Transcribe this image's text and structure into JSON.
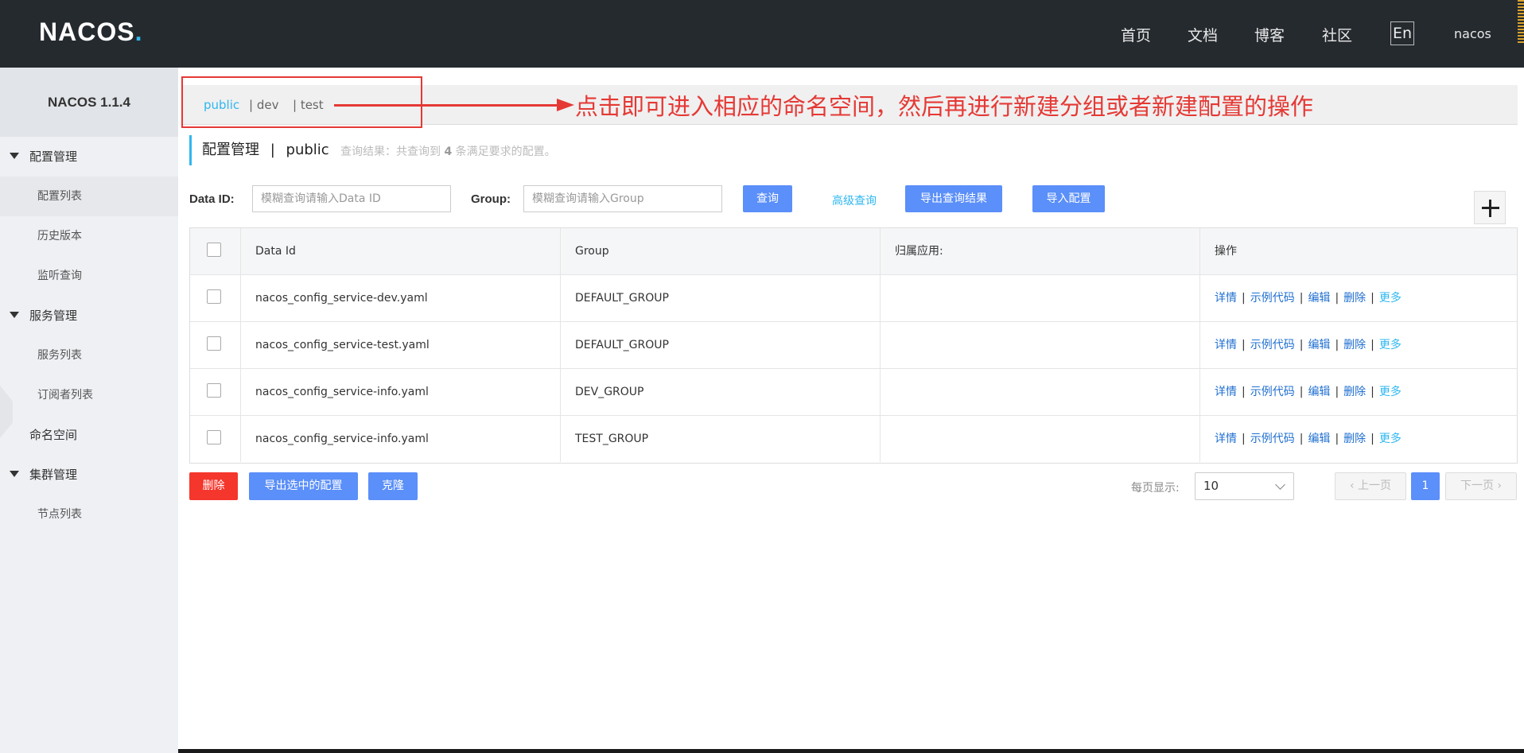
{
  "header": {
    "logo": "NACOS.",
    "nav": [
      "首页",
      "文档",
      "博客",
      "社区"
    ],
    "lang": "En",
    "user": "nacos"
  },
  "sidebar": {
    "title": "NACOS 1.1.4",
    "groups": [
      {
        "label": "配置管理",
        "items": [
          "配置列表",
          "历史版本",
          "监听查询"
        ]
      },
      {
        "label": "服务管理",
        "items": [
          "服务列表",
          "订阅者列表"
        ]
      },
      {
        "label": "命名空间"
      },
      {
        "label": "集群管理",
        "items": [
          "节点列表"
        ]
      }
    ]
  },
  "namespaces": [
    "public",
    "| dev",
    "| test"
  ],
  "annotation": "点击即可进入相应的命名空间，然后再进行新建分组或者新建配置的操作",
  "title": {
    "main": "配置管理",
    "sep": "|",
    "ns": "public",
    "result_prefix": "查询结果：共查询到",
    "result_count": "4",
    "result_suffix": "条满足要求的配置。"
  },
  "search": {
    "dataid_label": "Data ID:",
    "dataid_placeholder": "模糊查询请输入Data ID",
    "group_label": "Group:",
    "group_placeholder": "模糊查询请输入Group",
    "query_btn": "查询",
    "advanced": "高级查询",
    "export_results": "导出查询结果",
    "import": "导入配置"
  },
  "table": {
    "columns": [
      "Data Id",
      "Group",
      "归属应用:",
      "操作"
    ],
    "rows": [
      {
        "data_id": "nacos_config_service-dev.yaml",
        "group": "DEFAULT_GROUP",
        "app": ""
      },
      {
        "data_id": "nacos_config_service-test.yaml",
        "group": "DEFAULT_GROUP",
        "app": ""
      },
      {
        "data_id": "nacos_config_service-info.yaml",
        "group": "DEV_GROUP",
        "app": ""
      },
      {
        "data_id": "nacos_config_service-info.yaml",
        "group": "TEST_GROUP",
        "app": ""
      }
    ],
    "ops": [
      "详情",
      "示例代码",
      "编辑",
      "删除",
      "更多"
    ],
    "op_sep": "|"
  },
  "footer": {
    "delete": "删除",
    "export_selected": "导出选中的配置",
    "clone": "克隆",
    "page_size_label": "每页显示:",
    "page_size": "10",
    "prev": "上一页",
    "page": "1",
    "next": "下一页"
  },
  "colors": {
    "accent": "#5b8ff9",
    "link": "#2fb7f0",
    "danger": "#f5362c",
    "annotation": "#e53935"
  }
}
